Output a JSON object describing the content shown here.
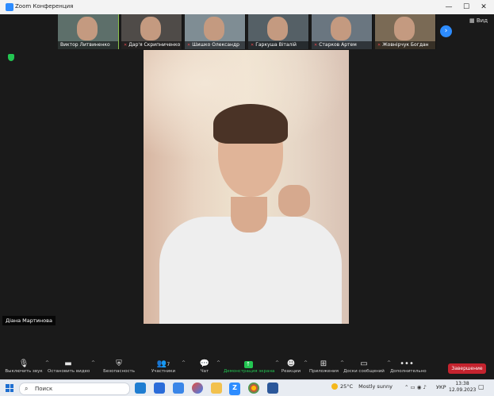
{
  "window": {
    "title": "Zoom Конференция",
    "min": "—",
    "max": "☐",
    "close": "✕"
  },
  "view_label": "Вид",
  "participants": [
    {
      "name": "Виктор Литвиненко",
      "muted": false,
      "active": true,
      "bg": "#5d6f6a"
    },
    {
      "name": "Дар'я Скрипниченко",
      "muted": true,
      "active": false,
      "bg": "#4f4b48"
    },
    {
      "name": "Шишко Олександр",
      "muted": true,
      "active": false,
      "bg": "#7f8d94"
    },
    {
      "name": "Гаркуша Віталій",
      "muted": true,
      "active": false,
      "bg": "#556066"
    },
    {
      "name": "Старков Артем",
      "muted": true,
      "active": false,
      "bg": "#6a7680"
    },
    {
      "name": "Жовнірчук Богдан",
      "muted": true,
      "active": false,
      "bg": "#7a6a55"
    }
  ],
  "speaker_name": "Діана Мартинова",
  "toolbar": {
    "audio": "Выключить звук",
    "video": "Остановить видео",
    "security": "Безопасность",
    "participants": "Участники",
    "participants_count": "7",
    "chat": "Чат",
    "share": "Демонстрация экрана",
    "reactions": "Реакции",
    "apps": "Приложения",
    "whiteboard": "Доски сообщений",
    "more": "Дополнительно",
    "end": "Завершение"
  },
  "taskbar": {
    "search": "Поиск",
    "temp": "25°C",
    "weather": "Mostly sunny",
    "lang": "УКР",
    "time": "13:38",
    "date": "12.09.2023"
  }
}
